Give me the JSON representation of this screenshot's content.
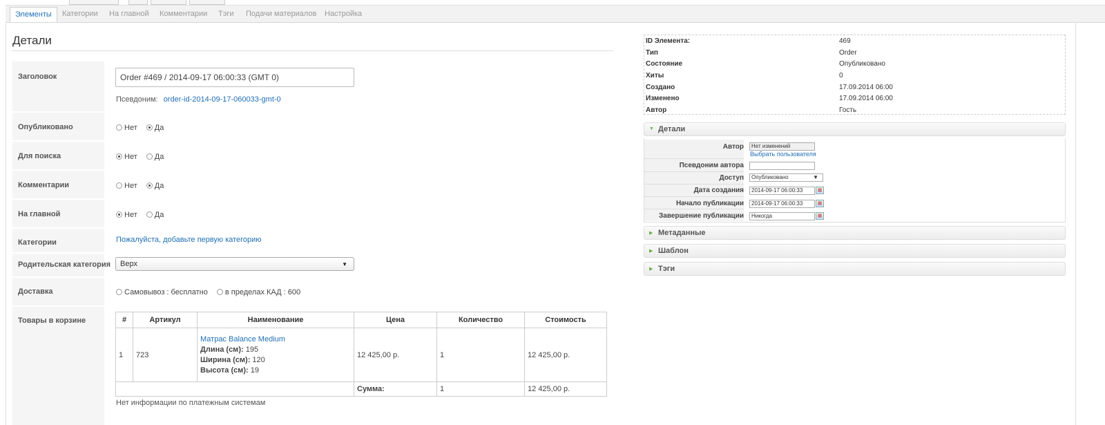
{
  "tabs": [
    "Элементы",
    "Категории",
    "На главной",
    "Комментарии",
    "Тэги",
    "Подачи материалов",
    "Настройка"
  ],
  "section_title": "Детали",
  "form": {
    "title_label": "Заголовок",
    "title_value": "Order #469 / 2014-09-17 06:00:33 (GMT 0)",
    "alias_label": "Псевдоним:",
    "alias_value": "order-id-2014-09-17-060033-gmt-0",
    "published_label": "Опубликовано",
    "search_label": "Для поиска",
    "comments_label": "Комментарии",
    "frontpage_label": "На главной",
    "categories_label": "Категории",
    "categories_link": "Пожалуйста, добавьте первую категорию",
    "parent_label": "Родительская категория",
    "parent_value": "Верх",
    "delivery_label": "Доставка",
    "delivery_opt1": "Самовывоз : бесплатно",
    "delivery_opt2": "в пределах КАД : 600",
    "cart_label": "Товары в корзине",
    "no": "Нет",
    "yes": "Да",
    "no_payment": "Нет информации по платежным системам"
  },
  "cart": {
    "headers": [
      "#",
      "Артикул",
      "Наименование",
      "Цена",
      "Количество",
      "Стоимость"
    ],
    "row": {
      "num": "1",
      "sku": "723",
      "name": "Матрас Balance Medium",
      "len_label": "Длина (см):",
      "len_value": "195",
      "wid_label": "Ширина (см):",
      "wid_value": "120",
      "hei_label": "Высота (см):",
      "hei_value": "19",
      "price": "12 425,00 р.",
      "qty": "1",
      "cost": "12 425,00 р."
    },
    "sum_label": "Сумма:",
    "sum_qty": "1",
    "sum_cost": "12 425,00 р."
  },
  "info": [
    {
      "k": "ID Элемента:",
      "v": "469"
    },
    {
      "k": "Тип",
      "v": "Order"
    },
    {
      "k": "Состояние",
      "v": "Опубликовано"
    },
    {
      "k": "Хиты",
      "v": "0"
    },
    {
      "k": "Создано",
      "v": "17.09.2014 06:00"
    },
    {
      "k": "Изменено",
      "v": "17.09.2014 06:00"
    },
    {
      "k": "Автор",
      "v": "Гость"
    }
  ],
  "details_panel": {
    "title": "Детали",
    "author_label": "Автор",
    "author_value": "Нет изменений",
    "choose_user": "Выбрать пользователя",
    "author_alias_label": "Псевдоним автора",
    "access_label": "Доступ",
    "access_value": "Опубликовано",
    "created_label": "Дата создания",
    "created_value": "2014-09-17 06:00:33",
    "pub_start_label": "Начало публикации",
    "pub_start_value": "2014-09-17 06:00:33",
    "pub_end_label": "Завершение публикации",
    "pub_end_value": "Никогда"
  },
  "panels": [
    "Метаданные",
    "Шаблон",
    "Тэги"
  ]
}
